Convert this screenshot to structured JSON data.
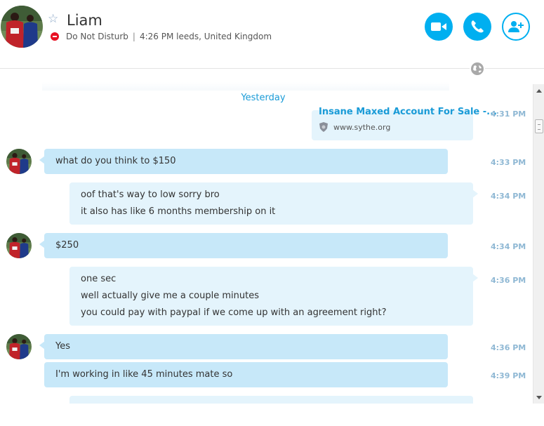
{
  "contact": {
    "name": "Liam",
    "status": "Do Not Disturb",
    "local_time": "4:26 PM leeds, United Kingdom"
  },
  "icons": {
    "favorite": "star-outline-icon",
    "status": "do-not-disturb-icon",
    "video": "video-camera-icon",
    "call": "phone-icon",
    "add_people": "add-person-icon",
    "translator": "globe-icon"
  },
  "colors": {
    "accent": "#00aff0",
    "incoming_bubble": "#c7e8f9",
    "outgoing_bubble": "#e4f4fc",
    "timestamp": "#8fb8d4",
    "dnd": "#e81123"
  },
  "conversation": {
    "date_separator": "Yesterday",
    "link_message": {
      "title": "Insane Maxed Account For Sale -...",
      "domain": "www.sythe.org",
      "time": "4:31 PM"
    },
    "messages": [
      {
        "lines": [
          "what do you think to $150"
        ],
        "time": "4:33 PM"
      },
      {
        "lines": [
          "oof that's way to low sorry bro",
          "it also has like 6 months membership on it"
        ],
        "time": "4:34 PM"
      },
      {
        "lines": [
          "$250"
        ],
        "time": "4:34 PM"
      },
      {
        "lines": [
          "one sec",
          "well actually give me a couple minutes",
          "you could pay with paypal if we come up with an agreement right?"
        ],
        "time": "4:36 PM"
      },
      {
        "lines": [
          "Yes"
        ],
        "time": "4:36 PM"
      },
      {
        "lines": [
          "I'm working in like 45 minutes mate so"
        ],
        "time": "4:39 PM"
      }
    ]
  }
}
